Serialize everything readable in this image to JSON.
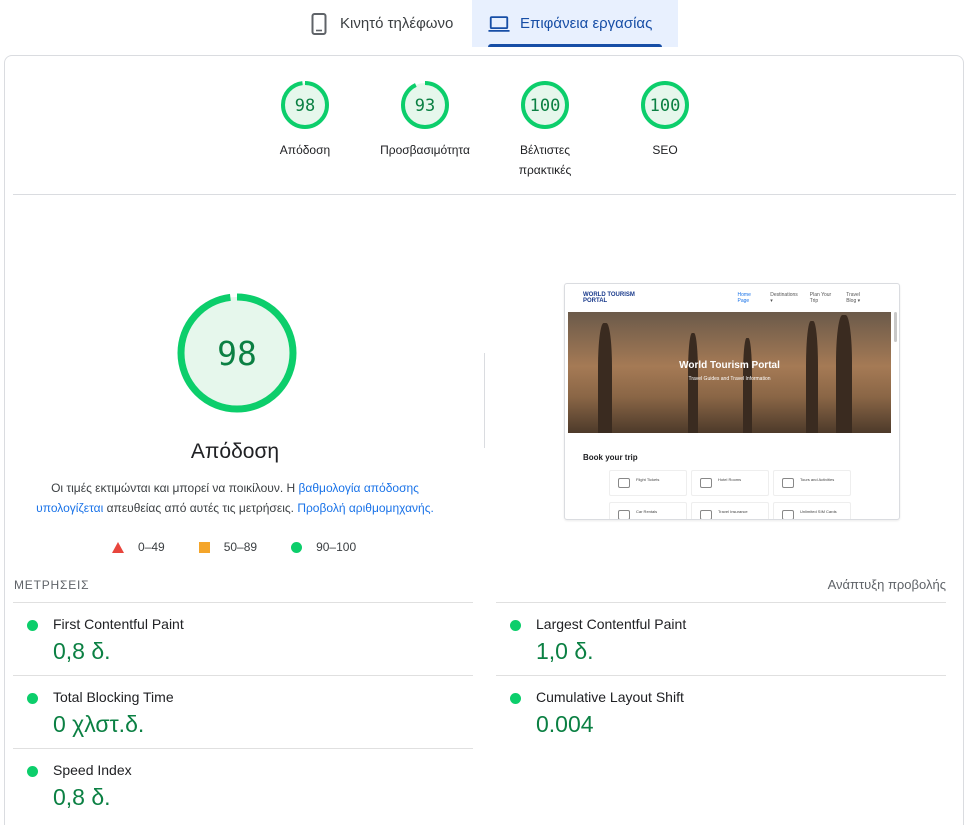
{
  "tabs": [
    {
      "label": "Κινητό τηλέφωνο",
      "icon": "phone-icon",
      "active": false
    },
    {
      "label": "Επιφάνεια εργασίας",
      "icon": "laptop-icon",
      "active": true
    }
  ],
  "scores": [
    {
      "value": 98,
      "label": "Απόδοση",
      "fraction": 0.98
    },
    {
      "value": 93,
      "label": "Προσβασιμότητα",
      "fraction": 0.93
    },
    {
      "value": 100,
      "label_line1": "Βέλτιστες",
      "label_line2": "πρακτικές",
      "fraction": 1.0
    },
    {
      "value": 100,
      "label": "SEO",
      "fraction": 1.0
    }
  ],
  "performance": {
    "score": 98,
    "fraction": 0.98,
    "title": "Απόδοση",
    "desc_part1": "Οι τιμές εκτιμώνται και μπορεί να ποικίλουν. Η ",
    "desc_link1": "βαθμολογία απόδοσης υπολογίζεται",
    "desc_part2": " απευθείας από αυτές τις μετρήσεις. ",
    "desc_link2": "Προβολή αριθμομηχανής."
  },
  "legend": {
    "fail": "0–49",
    "average": "50–89",
    "pass": "90–100"
  },
  "colors": {
    "pass": "#0cce6b",
    "pass_text": "#0b8043",
    "average": "#f4a52a",
    "fail": "#e8453c",
    "link": "#1a73e8",
    "active_tab": "#174ea6"
  },
  "thumbnail": {
    "logo": "WORLD TOURISM PORTAL",
    "menu": [
      "Home Page",
      "Destinations ▾",
      "Plan Your Trip",
      "Travel Blog ▾"
    ],
    "hero_title": "World Tourism Portal",
    "hero_subtitle": "Travel Guides and Travel Information",
    "book_title": "Book your trip",
    "tiles": [
      "Flight Tickets",
      "Hotel Rooms",
      "Tours and Activities",
      "Car Rentals",
      "Travel Insurance",
      "Unlimited SIM Cards"
    ]
  },
  "metrics": {
    "header": "ΜΕΤΡΗΣΕΙΣ",
    "expand_label": "Ανάπτυξη προβολής",
    "left": [
      {
        "name": "First Contentful Paint",
        "value": "0,8 δ."
      },
      {
        "name": "Total Blocking Time",
        "value": "0 χλστ.δ."
      },
      {
        "name": "Speed Index",
        "value": "0,8 δ."
      }
    ],
    "right": [
      {
        "name": "Largest Contentful Paint",
        "value": "1,0 δ."
      },
      {
        "name": "Cumulative Layout Shift",
        "value": "0.004"
      }
    ]
  }
}
